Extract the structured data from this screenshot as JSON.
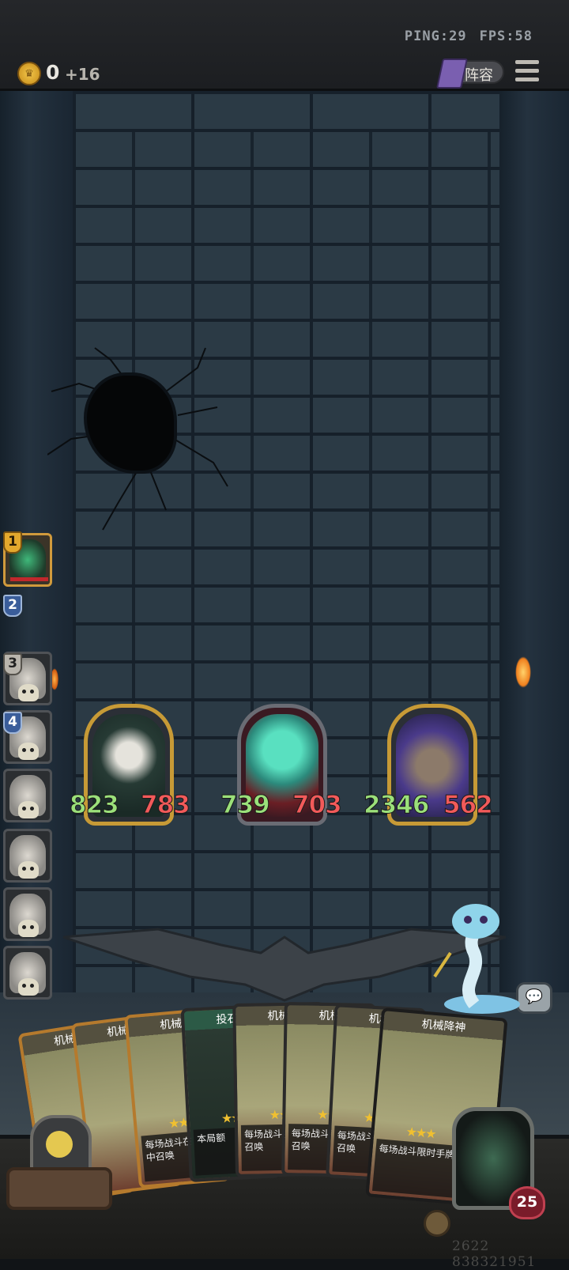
{
  "status": {
    "ping": "PING:29",
    "fps": "FPS:58"
  },
  "currency": {
    "gold": "0",
    "income": "+16"
  },
  "header": {
    "lineup_label": "阵容"
  },
  "roster": {
    "slots": [
      {
        "num": "1",
        "state": "alive"
      },
      {
        "num": "2",
        "state": "empty"
      },
      {
        "num": "3",
        "state": "dead"
      },
      {
        "num": "4",
        "state": "dead"
      },
      {
        "num": "",
        "state": "dead"
      },
      {
        "num": "",
        "state": "dead"
      },
      {
        "num": "",
        "state": "dead"
      },
      {
        "num": "",
        "state": "dead"
      }
    ]
  },
  "board": {
    "units": [
      {
        "attack": "823",
        "health": "783"
      },
      {
        "attack": "739",
        "health": "703"
      },
      {
        "attack": "2346",
        "health": "562"
      }
    ]
  },
  "hand": {
    "cards": [
      {
        "title": "机械",
        "text": ""
      },
      {
        "title": "机械",
        "text": ""
      },
      {
        "title": "机械",
        "text": "每场战斗在手牌中召唤"
      },
      {
        "title": "投石",
        "text": "本局额"
      },
      {
        "title": "机械",
        "text": "每场战斗手牌中召唤"
      },
      {
        "title": "机械",
        "text": "每场战斗手牌中召唤"
      },
      {
        "title": "机械",
        "text": "每场战斗手牌中召唤"
      },
      {
        "title": "机械降神",
        "text": "每场战斗限时手牌中且"
      }
    ]
  },
  "hero": {
    "health": "25"
  },
  "footer": {
    "id": "2622 838321951"
  }
}
